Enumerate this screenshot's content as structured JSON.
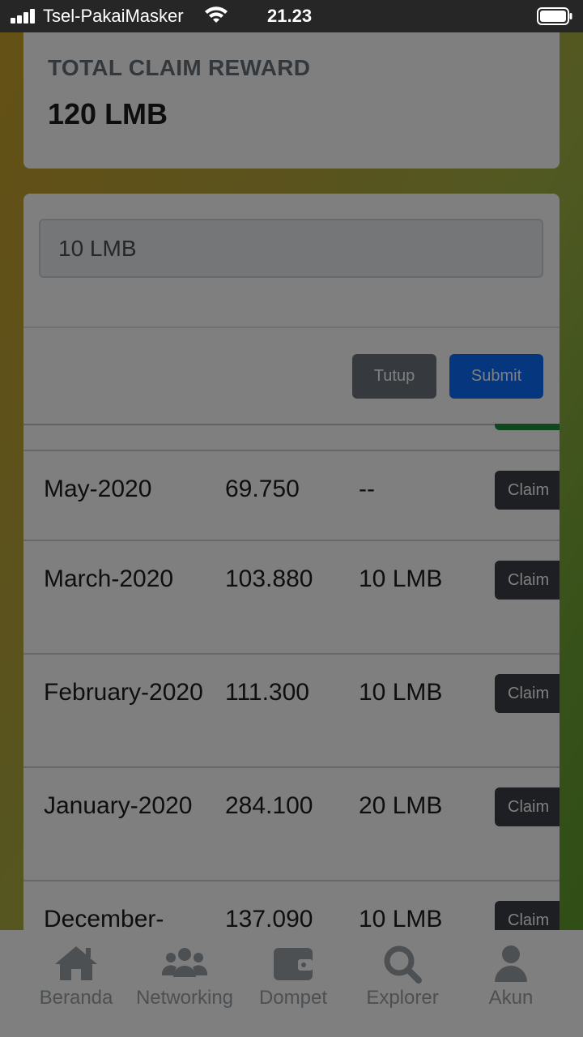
{
  "status_bar": {
    "carrier": "Tsel-PakaiMasker",
    "time": "21.23"
  },
  "summary": {
    "label": "TOTAL CLAIM REWARD",
    "value": "120 LMB"
  },
  "modal": {
    "input_value": "10 LMB",
    "close_label": "Tutup",
    "submit_label": "Submit"
  },
  "rows": [
    {
      "month": "May-2020",
      "value": "69.750",
      "reward": "--",
      "button": "Claim"
    },
    {
      "month": "March-2020",
      "value": "103.880",
      "reward": "10 LMB",
      "button": "Claim"
    },
    {
      "month": "February-2020",
      "value": "111.300",
      "reward": "10 LMB",
      "button": "Claim"
    },
    {
      "month": "January-2020",
      "value": "284.100",
      "reward": "20 LMB",
      "button": "Claim"
    },
    {
      "month": "December-",
      "value": "137.090",
      "reward": "10 LMB",
      "button": "Claim"
    }
  ],
  "nav": [
    {
      "label": "Beranda",
      "icon": "home-icon"
    },
    {
      "label": "Networking",
      "icon": "users-icon"
    },
    {
      "label": "Dompet",
      "icon": "wallet-icon"
    },
    {
      "label": "Explorer",
      "icon": "search-icon"
    },
    {
      "label": "Akun",
      "icon": "user-icon"
    }
  ]
}
